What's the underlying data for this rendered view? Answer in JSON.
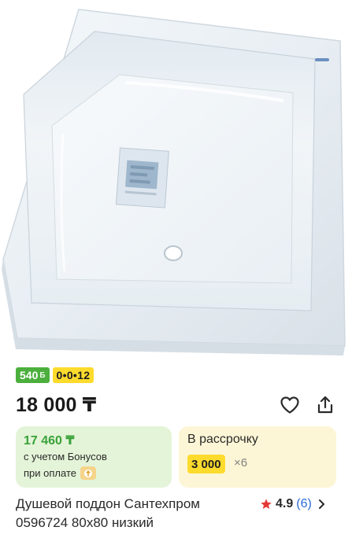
{
  "product": {
    "image_alt": "Душевой поддон",
    "badges": {
      "bonus_value": "540",
      "bonus_currency": "Б",
      "installment": "0•0•12"
    },
    "price": "18 000 ₸",
    "bonus_card": {
      "price": "17 460 ₸",
      "note_line1": "с учетом Бонусов",
      "note_line2": "при оплате"
    },
    "installment_card": {
      "title": "В рассрочку",
      "amount": "3 000",
      "multiplier": "×6"
    },
    "title_line1": "Душевой поддон Сантехпром",
    "title_line2": "0596724 80x80 низкий",
    "rating": {
      "value": "4.9",
      "count": "(6)"
    }
  },
  "colors": {
    "bonus_green": "#4caf3d",
    "installment_yellow": "#fddb2d",
    "star_red": "#e53935",
    "link_blue": "#2a6ad8"
  },
  "icons": {
    "favorite": "heart-icon",
    "share": "share-icon",
    "star": "star-icon",
    "chevron": "chevron-right-icon",
    "payment": "payment-icon"
  }
}
